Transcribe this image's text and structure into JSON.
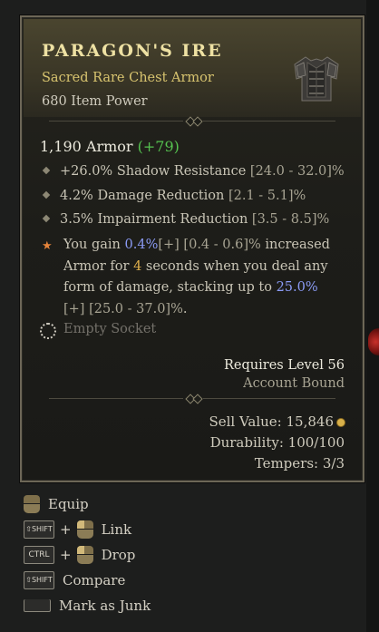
{
  "item": {
    "name": "PARAGON'S IRE",
    "type": "Sacred Rare Chest Armor",
    "item_power": "680 Item Power",
    "armor_value": "1,190 Armor",
    "armor_delta": "(+79)",
    "affixes": [
      {
        "text": "+26.0% Shadow Resistance ",
        "range": "[24.0 - 32.0]%"
      },
      {
        "text": "4.2% Damage Reduction ",
        "range": "[2.1 - 5.1]%"
      },
      {
        "text": "3.5% Impairment Reduction ",
        "range": "[3.5 - 8.5]%"
      }
    ],
    "legendary": {
      "p1": "You gain ",
      "v1": "0.4%",
      "r1": "[+] [0.4 - 0.6]%",
      "p2": " increased Armor for ",
      "v2": "4",
      "p3": " seconds when you deal any form of damage, stacking up to ",
      "v3": "25.0%",
      "r3": "[+] [25.0 - 37.0]%",
      "p4": "."
    },
    "socket": "Empty Socket",
    "requires_level": "Requires Level 56",
    "binding": "Account Bound",
    "sell_value": "Sell Value: 15,846",
    "durability": "Durability: 100/100",
    "tempers": "Tempers: 3/3"
  },
  "actions": [
    {
      "label": "Equip"
    },
    {
      "key": "SHIFT",
      "label": "Link"
    },
    {
      "key": "CTRL",
      "label": "Drop"
    },
    {
      "key": "SHIFT",
      "label": "Compare"
    },
    {
      "label": "Mark as Junk"
    }
  ],
  "colors": {
    "title": "#eee1a3",
    "rare": "#d8c46f",
    "positive": "#55c24f",
    "value_blue": "#8b9bf5",
    "value_orange": "#e0b04c",
    "legendary_star": "#e5843b"
  },
  "icons": [
    "chest-armor-icon",
    "affix-diamond-icon",
    "legendary-star-icon",
    "socket-icon",
    "gold-coin-icon",
    "mouse-right-icon",
    "mouse-left-icon",
    "shift-key-icon",
    "ctrl-key-icon",
    "spacebar-key-icon"
  ]
}
